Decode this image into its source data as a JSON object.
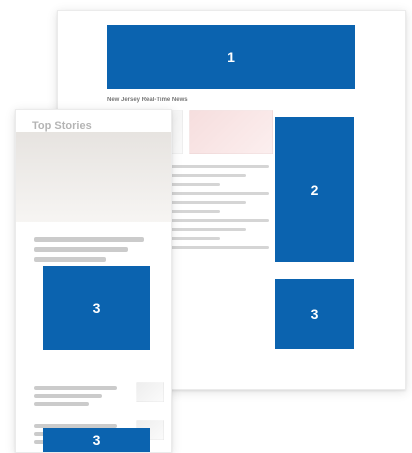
{
  "desktop": {
    "section_title": "New Jersey Real-Time News",
    "ads": [
      {
        "label": "1"
      },
      {
        "label": "2"
      },
      {
        "label": "3"
      }
    ]
  },
  "mobile": {
    "title": "Top Stories",
    "ads": [
      {
        "label": "3"
      },
      {
        "label": "3"
      }
    ]
  },
  "colors": {
    "ad_blue": "#0B63AF"
  }
}
